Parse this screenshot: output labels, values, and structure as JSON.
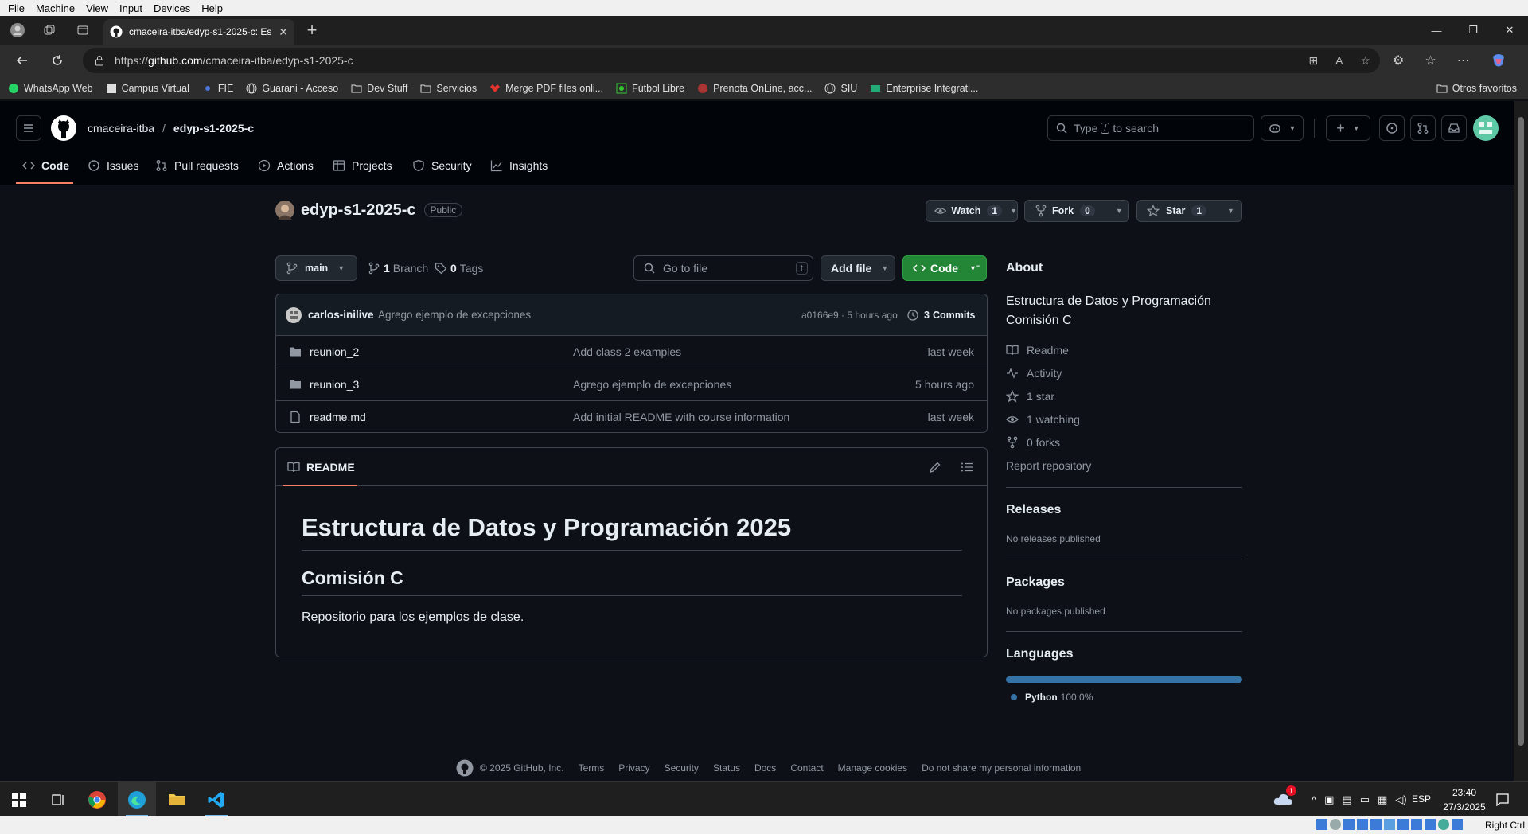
{
  "vm_menu": [
    "File",
    "Machine",
    "View",
    "Input",
    "Devices",
    "Help"
  ],
  "browser": {
    "tab_title": "cmaceira-itba/edyp-s1-2025-c: Es",
    "url_prefix": "https://",
    "url_host": "github.com",
    "url_path": "/cmaceira-itba/edyp-s1-2025-c"
  },
  "bookmarks": [
    "WhatsApp Web",
    "Campus Virtual",
    "FIE",
    "Guarani - Acceso",
    "Dev Stuff",
    "Servicios",
    "Merge PDF files onli...",
    "Fútbol Libre",
    "Prenota OnLine, acc...",
    "SIU",
    "Enterprise Integrati..."
  ],
  "other_favorites": "Otros favoritos",
  "header": {
    "owner": "cmaceira-itba",
    "separator": "/",
    "repo": "edyp-s1-2025-c",
    "search_prefix": "Type",
    "search_key": "/",
    "search_suffix": "to search"
  },
  "nav": [
    "Code",
    "Issues",
    "Pull requests",
    "Actions",
    "Projects",
    "Security",
    "Insights"
  ],
  "repo": {
    "name": "edyp-s1-2025-c",
    "visibility": "Public",
    "watch_label": "Watch",
    "watch_count": "1",
    "fork_label": "Fork",
    "fork_count": "0",
    "star_label": "Star",
    "star_count": "1"
  },
  "toolbar": {
    "branch": "main",
    "branches_count": "1",
    "branches_label": "Branch",
    "tags_count": "0",
    "tags_label": "Tags",
    "go_to_file": "Go to file",
    "go_to_file_key": "t",
    "add_file": "Add file",
    "code": "Code"
  },
  "last_commit": {
    "author": "carlos-inilive",
    "message": "Agrego ejemplo de excepciones",
    "hash_time": "a0166e9 · 5 hours ago",
    "commits_count": "3",
    "commits_label": "Commits"
  },
  "files": [
    {
      "name": "reunion_2",
      "type": "dir",
      "message": "Add class 2 examples",
      "date": "last week"
    },
    {
      "name": "reunion_3",
      "type": "dir",
      "message": "Agrego ejemplo de excepciones",
      "date": "5 hours ago"
    },
    {
      "name": "readme.md",
      "type": "file",
      "message": "Add initial README with course information",
      "date": "last week"
    }
  ],
  "readme": {
    "tab": "README",
    "h1": "Estructura de Datos y Programación 2025",
    "h2": "Comisión C",
    "p": "Repositorio para los ejemplos de clase."
  },
  "about": {
    "title": "About",
    "description": "Estructura de Datos y Programación Comisión C",
    "links": [
      "Readme",
      "Activity",
      "1 star",
      "1 watching",
      "0 forks"
    ],
    "report": "Report repository"
  },
  "releases": {
    "title": "Releases",
    "sub": "No releases published"
  },
  "packages": {
    "title": "Packages",
    "sub": "No packages published"
  },
  "languages": {
    "title": "Languages",
    "items": [
      {
        "name": "Python",
        "percent": "100.0%",
        "fraction": 1.0,
        "color": "#3572A5"
      }
    ]
  },
  "footer": [
    "© 2025 GitHub, Inc.",
    "Terms",
    "Privacy",
    "Security",
    "Status",
    "Docs",
    "Contact",
    "Manage cookies",
    "Do not share my personal information"
  ],
  "taskbar": {
    "lang": "ESP",
    "time": "23:40",
    "date": "27/3/2025",
    "notification_count": "1"
  },
  "vm_status": "Right Ctrl",
  "colors": {
    "accent_green": "#238636",
    "accent_orange": "#f78166",
    "link_blue": "#4493f8"
  }
}
